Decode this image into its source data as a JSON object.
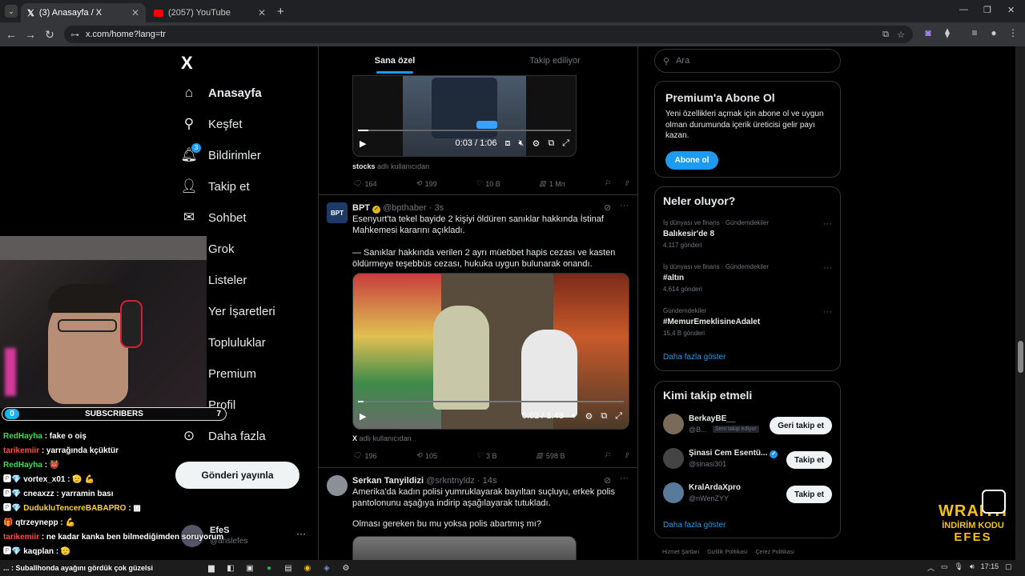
{
  "browser": {
    "tabs": [
      {
        "title": "(3) Anasayfa / X",
        "icon": "x-logo-icon",
        "active": true
      },
      {
        "title": "(2057) YouTube",
        "icon": "youtube-icon",
        "active": false
      }
    ],
    "new_tab": "+",
    "url": "x.com/home?lang=tr"
  },
  "sidebar": {
    "logo": "X",
    "items": [
      {
        "label": "Anasayfa",
        "icon": "home-icon"
      },
      {
        "label": "Keşfet",
        "icon": "search-icon"
      },
      {
        "label": "Bildirimler",
        "icon": "bell-icon",
        "badge": "3"
      },
      {
        "label": "Takip et",
        "icon": "add-person-icon"
      },
      {
        "label": "Sohbet",
        "icon": "mail-icon"
      },
      {
        "label": "Grok",
        "icon": "grok-icon"
      },
      {
        "label": "Listeler",
        "icon": "list-icon"
      },
      {
        "label": "Yer İşaretleri",
        "icon": "bookmark-icon"
      },
      {
        "label": "Topluluklar",
        "icon": "community-icon"
      },
      {
        "label": "Premium",
        "icon": "x-logo-icon"
      },
      {
        "label": "Profil",
        "icon": "profile-icon"
      },
      {
        "label": "Daha fazla",
        "icon": "more-circle-icon"
      }
    ],
    "post_button": "Gönderi yayınla",
    "account": {
      "name": "EfeS",
      "handle": "@ahslefes",
      "more": "···"
    }
  },
  "feed": {
    "tabs": [
      {
        "label": "Sana özel",
        "active": true
      },
      {
        "label": "Takip ediliyor",
        "active": false
      }
    ],
    "tweet1": {
      "video_time": "0:03 / 1:06",
      "video_progress": 0.05,
      "credit_user": "stocks",
      "credit_suffix": "adlı kullanıcıdan",
      "replies": "164",
      "reposts": "199",
      "likes": "10 B",
      "views": "1 Mn"
    },
    "tweet2": {
      "name": "BPT",
      "handle": "@bpthaber",
      "time": "· 3s",
      "avatar_text": "BPT",
      "line1": "Esenyurt'ta tekel bayide 2 kişiyi öldüren sanıklar hakkında İstinaf",
      "line2": "Mahkemesi kararını açıkladı.",
      "line3": "— Sanıklar hakkında verilen 2 ayrı müebbet hapis cezası ve kasten",
      "line4": "öldürmeye teşebbüs cezası, hukuka uygun bulunarak onandı.",
      "video_time": "0:02 / 1:48",
      "video_progress": 0.02,
      "credit_user": "X",
      "credit_suffix": "adlı kullanıcıdan",
      "replies": "196",
      "reposts": "105",
      "likes": "3 B",
      "views": "598 B"
    },
    "tweet3": {
      "name": "Serkan Tanyildizi",
      "handle": "@srkntnyldz",
      "time": "· 14s",
      "line1": "Amerika'da kadın polisi yumruklayarak bayıltan suçluyu, erkek polis",
      "line2": "pantolonunu aşağıya indirip aşağılayarak tutukladı.",
      "line3": "Olması gereken bu mu yoksa polis abartmış mı?"
    }
  },
  "right": {
    "search_placeholder": "Ara",
    "premium": {
      "title": "Premium'a Abone Ol",
      "body": "Yeni özellikleri açmak için abone ol ve uygun olman durumunda içerik üreticisi gelir payı kazan.",
      "button": "Abone ol"
    },
    "trends": {
      "title": "Neler oluyor?",
      "items": [
        {
          "category": "İş dünyası ve finans · Gündemdekiler",
          "name": "Balıkesir'de 8",
          "count": "4.117 gönderi"
        },
        {
          "category": "İş dünyası ve finans · Gündemdekiler",
          "name": "#altın",
          "count": "4.614 gönderi"
        },
        {
          "category": "Gündemdekiler",
          "name": "#MemurEmeklisineAdalet",
          "count": "15,4 B gönderi"
        }
      ],
      "more": "Daha fazla göster"
    },
    "who_to_follow": {
      "title": "Kimi takip etmeli",
      "items": [
        {
          "name": "BerkayBE__",
          "handle": "@B...",
          "tag": "Seni takip ediyor",
          "button": "Geri takip et",
          "verified": false
        },
        {
          "name": "Şinasi Cem Esentü...",
          "handle": "@sinasi301",
          "tag": "",
          "button": "Takip et",
          "verified": true
        },
        {
          "name": "KralArdaXpro",
          "handle": "@nWenZYY",
          "tag": "",
          "button": "Takip et",
          "verified": false
        }
      ],
      "more": "Daha fazla göster"
    },
    "footer": [
      "Hizmet Şartları",
      "Gizlilik Politikası",
      "Çerez Politikası"
    ]
  },
  "overlay": {
    "subscribers_left": "0",
    "subscribers_label": "SUBSCRIBERS",
    "subscribers_right": "7",
    "subscribers_progress": 0.0,
    "chat": [
      {
        "user": "RedHayha",
        "msg": ": fake o oiş",
        "color": "#3ddc53"
      },
      {
        "user": "tarikemiir",
        "msg": ": yarrağında kçüktür",
        "color": "#ff4a4a"
      },
      {
        "user": "RedHayha",
        "msg": ": 👹",
        "color": "#3ddc53"
      },
      {
        "user": "vortex_x01",
        "msg": ": 🫡 💪",
        "color": "#ffffff",
        "badges": "🅿💎"
      },
      {
        "user": "cneaxzz",
        "msg": ": yarramin bası",
        "color": "#ffffff",
        "badges": "🅿💎"
      },
      {
        "user": "DudukluTencereBABAPRO",
        "msg": ":",
        "color": "#ffd23a",
        "badges": "🅿💎"
      },
      {
        "user": "qtrzeynepp",
        "msg": ": 💪",
        "color": "#ffffff",
        "badges": "🎁"
      },
      {
        "user": "tarikemiir",
        "msg": ": ne kadar kanka ben bilmediğimden soruyorum",
        "color": "#ff4a4a"
      },
      {
        "user": "kaqplan",
        "msg": ": 🫡",
        "color": "#ffffff",
        "badges": "🅿💎"
      },
      {
        "user": "...",
        "msg": ": Suballhonda ayağını gördük çok güzelsi",
        "color": "#ffffff"
      }
    ],
    "promo_brand": "WRAITH",
    "promo_line2": "İNDİRİM KODU",
    "promo_code": "EFES"
  },
  "taskbar": {
    "time": "17:15"
  }
}
